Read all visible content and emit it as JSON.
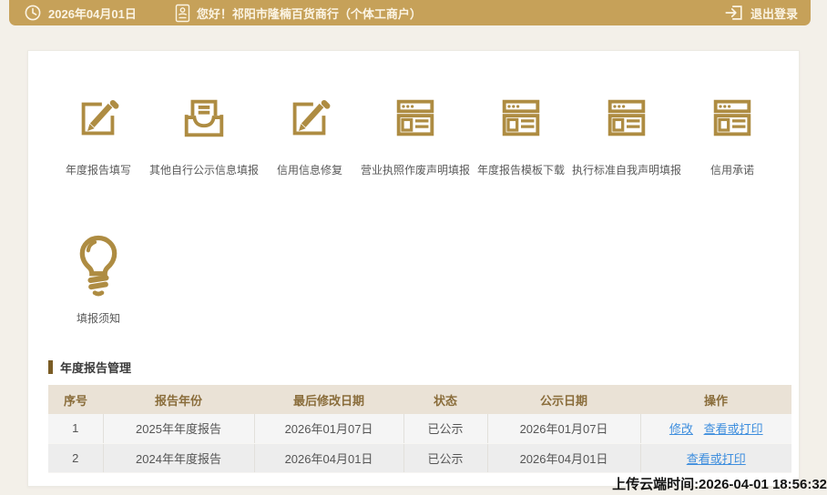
{
  "topbar": {
    "date": "2026年04月01日",
    "greeting": "您好！祁阳市隆楠百货商行（个体工商户）",
    "logout_label": "退出登录",
    "bg_color": "#C6A159",
    "text_color": "#FBF4E4"
  },
  "menu": {
    "icon_color": "#AE8C42",
    "items": [
      {
        "label": "年度报告填写",
        "icon": "edit-icon"
      },
      {
        "label": "其他自行公示信息填报",
        "icon": "inbox-document-icon"
      },
      {
        "label": "信用信息修复",
        "icon": "edit-icon"
      },
      {
        "label": "营业执照作废声明填报",
        "icon": "webpage-icon"
      },
      {
        "label": "年度报告模板下载",
        "icon": "webpage-icon"
      },
      {
        "label": "执行标准自我声明填报",
        "icon": "webpage-icon"
      },
      {
        "label": "信用承诺",
        "icon": "webpage-icon"
      }
    ],
    "secondary": [
      {
        "label": "填报须知",
        "icon": "lightbulb-icon"
      }
    ]
  },
  "report_section": {
    "title": "年度报告管理",
    "accent_color": "#7A5C25",
    "table": {
      "header_bg": "#EAE2D6",
      "header_text_color": "#8A6D3B",
      "link_color": "#3E8EDE",
      "headers": [
        "序号",
        "报告年份",
        "最后修改日期",
        "状态",
        "公示日期",
        "操作"
      ],
      "rows": [
        {
          "index": "1",
          "year": "2025年年度报告",
          "modified": "2026年01月07日",
          "status": "已公示",
          "published": "2026年01月07日",
          "actions": [
            {
              "label": "修改"
            },
            {
              "label": "查看或打印"
            }
          ]
        },
        {
          "index": "2",
          "year": "2024年年度报告",
          "modified": "2026年04月01日",
          "status": "已公示",
          "published": "2026年04月01日",
          "actions": [
            {
              "label": "查看或打印"
            }
          ]
        }
      ]
    }
  },
  "footer": {
    "upload_time": "上传云端时间:2026-04-01 18:56:32"
  }
}
